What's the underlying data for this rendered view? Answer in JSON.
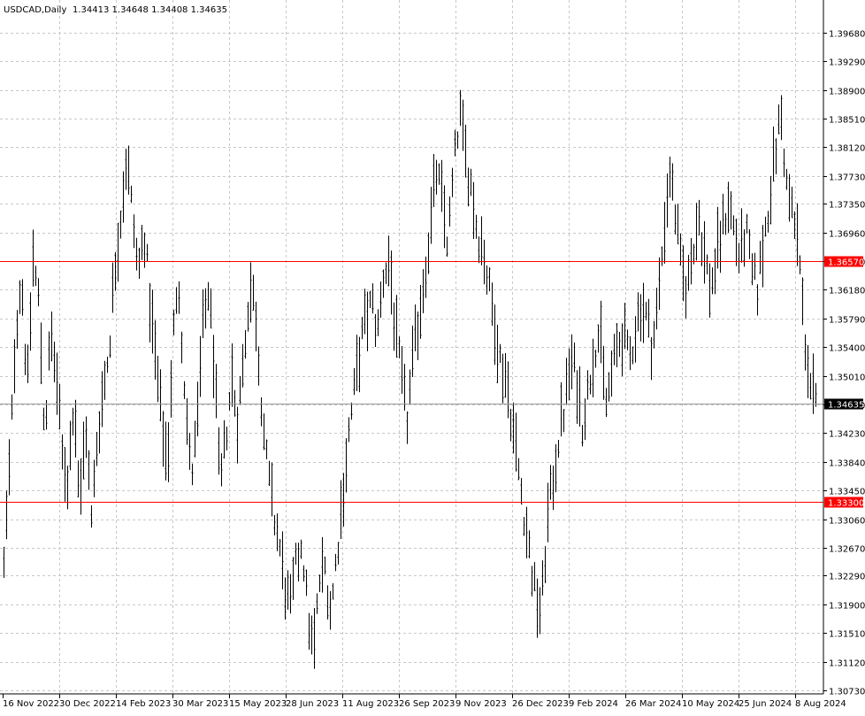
{
  "header": {
    "symbol": "USDCAD,Daily",
    "ohlc": "1.34413 1.34648 1.34408 1.34635"
  },
  "colors": {
    "background": "#ffffff",
    "grid": "#c8c8c8",
    "bars": "#000000",
    "level_line": "#ff0000",
    "level_tag": "#ff0000",
    "current_tag": "#000000"
  },
  "chart_data": {
    "type": "ohlc",
    "title": "USDCAD,Daily",
    "xlabel": "",
    "ylabel": "",
    "grid": true,
    "ylim": [
      1.3073,
      1.3987
    ],
    "y_ticks": [
      "1.39680",
      "1.39290",
      "1.38900",
      "1.38510",
      "1.38120",
      "1.37730",
      "1.37350",
      "1.36960",
      "1.36570",
      "1.36180",
      "1.35790",
      "1.35400",
      "1.35010",
      "1.34620",
      "1.34230",
      "1.33840",
      "1.33450",
      "1.33060",
      "1.32670",
      "1.32290",
      "1.31900",
      "1.31510",
      "1.31120",
      "1.30730"
    ],
    "x_ticks": [
      "16 Nov 2022",
      "30 Dec 2022",
      "14 Feb 2023",
      "30 Mar 2023",
      "15 May 2023",
      "28 Jun 2023",
      "11 Aug 2023",
      "26 Sep 2023",
      "9 Nov 2023",
      "26 Dec 2023",
      "9 Feb 2024",
      "26 Mar 2024",
      "10 May 2024",
      "25 Jun 2024",
      "8 Aug 2024"
    ],
    "horizontal_levels": [
      {
        "value": 1.3657,
        "label": "1.36570"
      },
      {
        "value": 1.333,
        "label": "1.33300"
      }
    ],
    "current_price": {
      "value": 1.34635,
      "label": "1.34635"
    },
    "price_path": [
      1.324,
      1.338,
      1.356,
      1.364,
      1.348,
      1.366,
      1.36,
      1.342,
      1.356,
      1.35,
      1.339,
      1.336,
      1.348,
      1.332,
      1.344,
      1.33,
      1.342,
      1.348,
      1.354,
      1.365,
      1.372,
      1.38,
      1.372,
      1.364,
      1.37,
      1.36,
      1.352,
      1.344,
      1.338,
      1.356,
      1.362,
      1.348,
      1.336,
      1.342,
      1.356,
      1.362,
      1.352,
      1.334,
      1.342,
      1.35,
      1.344,
      1.352,
      1.362,
      1.36,
      1.348,
      1.338,
      1.332,
      1.328,
      1.322,
      1.318,
      1.324,
      1.328,
      1.318,
      1.312,
      1.322,
      1.324,
      1.318,
      1.326,
      1.334,
      1.342,
      1.348,
      1.354,
      1.358,
      1.36,
      1.356,
      1.364,
      1.366,
      1.356,
      1.35,
      1.344,
      1.352,
      1.358,
      1.364,
      1.37,
      1.378,
      1.374,
      1.368,
      1.378,
      1.386,
      1.38,
      1.376,
      1.37,
      1.368,
      1.362,
      1.358,
      1.352,
      1.35,
      1.344,
      1.338,
      1.332,
      1.326,
      1.32,
      1.318,
      1.33,
      1.336,
      1.342,
      1.346,
      1.352,
      1.35,
      1.344,
      1.348,
      1.354,
      1.356,
      1.346,
      1.35,
      1.354,
      1.356,
      1.352,
      1.356,
      1.36,
      1.358,
      1.354,
      1.36,
      1.37,
      1.378,
      1.372,
      1.364,
      1.362,
      1.368,
      1.372,
      1.366,
      1.362,
      1.366,
      1.37,
      1.374,
      1.37,
      1.366,
      1.37,
      1.364,
      1.362,
      1.368,
      1.374,
      1.38,
      1.386,
      1.376,
      1.372,
      1.368,
      1.356,
      1.349,
      1.346
    ]
  }
}
